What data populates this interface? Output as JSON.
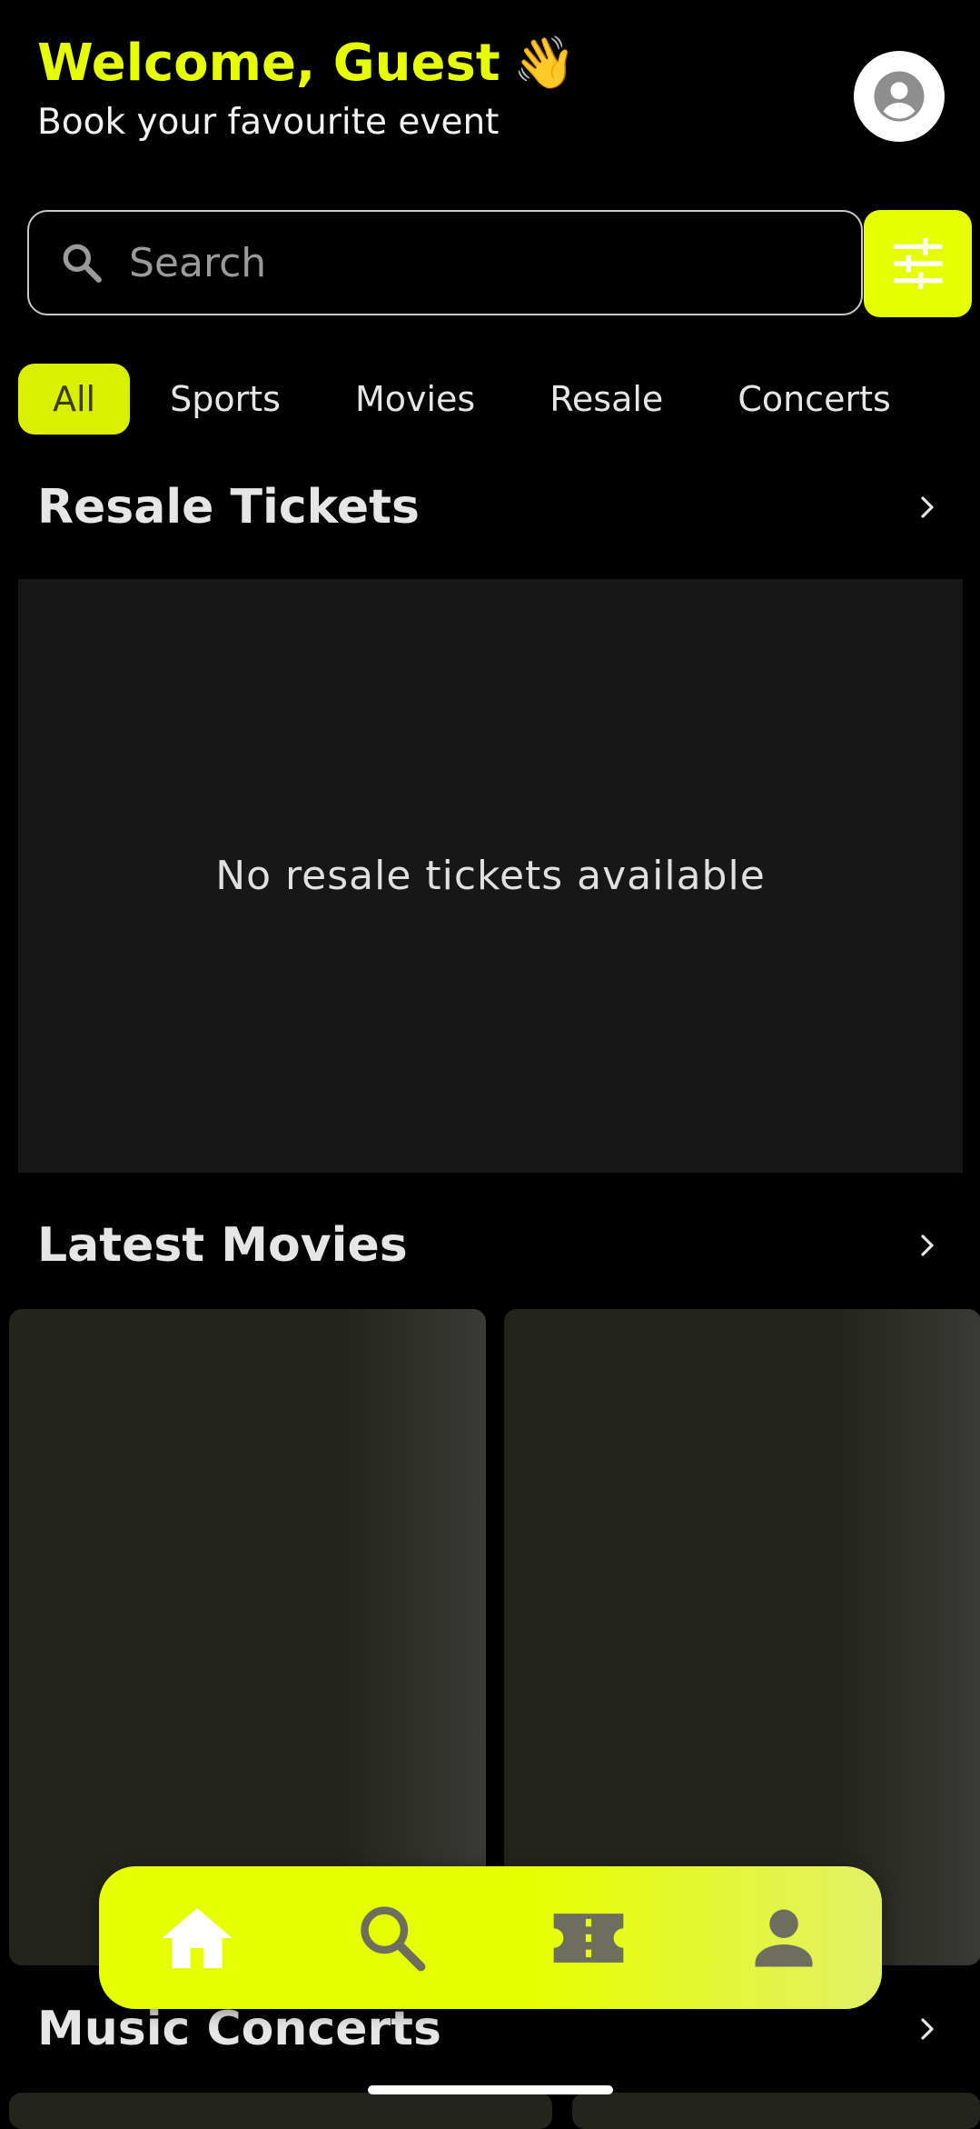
{
  "header": {
    "welcome": "Welcome, Guest",
    "wave_emoji": "👋",
    "subtitle": "Book your favourite event",
    "avatar_icon": "account-circle-icon"
  },
  "search": {
    "placeholder": "Search",
    "value": "",
    "icon": "search-icon",
    "filter_icon": "tune-sliders-icon"
  },
  "categories": [
    {
      "label": "All",
      "active": true
    },
    {
      "label": "Sports",
      "active": false
    },
    {
      "label": "Movies",
      "active": false
    },
    {
      "label": "Resale",
      "active": false
    },
    {
      "label": "Concerts",
      "active": false
    }
  ],
  "sections": {
    "resale": {
      "title": "Resale Tickets",
      "empty_message": "No resale tickets available"
    },
    "movies": {
      "title": "Latest Movies"
    },
    "concerts": {
      "title": "Music Concerts"
    }
  },
  "bottom_nav": [
    {
      "icon": "home-icon",
      "active": true
    },
    {
      "icon": "search-icon",
      "active": false
    },
    {
      "icon": "ticket-icon",
      "active": false
    },
    {
      "icon": "person-icon",
      "active": false
    }
  ],
  "colors": {
    "accent": "#e6ff00",
    "background": "#000000",
    "panel": "#171717",
    "chip_active": "#d9f000",
    "nav_icon_inactive": "#6e6e5e"
  }
}
